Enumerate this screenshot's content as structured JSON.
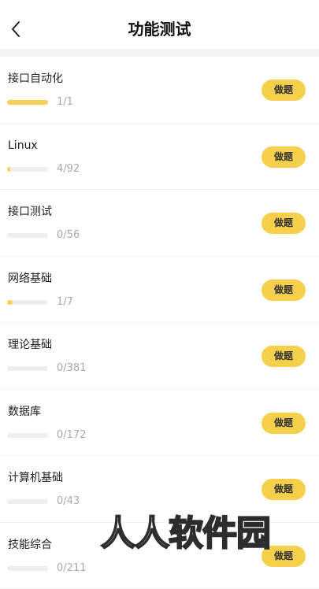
{
  "header": {
    "title": "功能测试",
    "back_icon": "chevron-left-icon"
  },
  "colors": {
    "accent": "#f6cf4b",
    "progress_fill": "#f6d154",
    "progress_track": "#eeeeee",
    "muted_text": "#a8a8a8"
  },
  "items": [
    {
      "title": "接口自动化",
      "progress_text": "1/1",
      "done": 1,
      "total": 1,
      "button_label": "做题"
    },
    {
      "title": "Linux",
      "progress_text": "4/92",
      "done": 4,
      "total": 92,
      "button_label": "做题"
    },
    {
      "title": "接口测试",
      "progress_text": "0/56",
      "done": 0,
      "total": 56,
      "button_label": "做题"
    },
    {
      "title": "网络基础",
      "progress_text": "1/7",
      "done": 1,
      "total": 7,
      "button_label": "做题"
    },
    {
      "title": "理论基础",
      "progress_text": "0/381",
      "done": 0,
      "total": 381,
      "button_label": "做题"
    },
    {
      "title": "数据库",
      "progress_text": "0/172",
      "done": 0,
      "total": 172,
      "button_label": "做题"
    },
    {
      "title": "计算机基础",
      "progress_text": "0/43",
      "done": 0,
      "total": 43,
      "button_label": "做题"
    },
    {
      "title": "技能综合",
      "progress_text": "0/211",
      "done": 0,
      "total": 211,
      "button_label": "做题"
    }
  ],
  "watermark": "人人软件园"
}
